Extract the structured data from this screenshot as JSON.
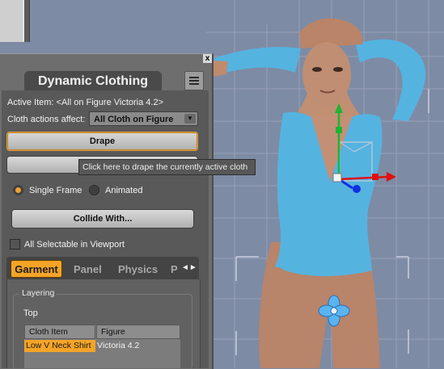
{
  "panel": {
    "title": "Dynamic Clothing",
    "close_glyph": "x",
    "active_item": "Active Item: <All on Figure Victoria 4.2>",
    "cloth_actions_label": "Cloth actions affect:",
    "cloth_actions_value": "All Cloth on Figure",
    "drape_label": "Drape",
    "second_button_label": "",
    "tooltip": "Click here to drape the currently active cloth",
    "single_frame_label": "Single Frame",
    "animated_label": "Animated",
    "frame_mode_selected": "Single Frame",
    "collide_label": "Collide With...",
    "all_selectable_label": "All Selectable in Viewport",
    "all_selectable_checked": false,
    "tabs": [
      {
        "label": "Garment",
        "active": true
      },
      {
        "label": "Panel",
        "active": false
      },
      {
        "label": "Physics",
        "active": false
      },
      {
        "label": "P",
        "active": false
      }
    ],
    "tab_nav_glyph": "◄►",
    "layering_legend": "Layering",
    "layering_top_label": "Top",
    "table": {
      "headers": [
        "Cloth Item",
        "Figure"
      ],
      "rows": [
        {
          "cloth_item": "Low V Neck Shirt",
          "figure": "Victoria 4.2",
          "selected": true
        }
      ]
    }
  },
  "icons": [
    "close-icon",
    "menu-icon",
    "dropdown-arrow-icon",
    "tab-nav-icon",
    "universal-manipulator-icon"
  ],
  "colors": {
    "accent": "#f4a426",
    "viewport": "#7e8ba4",
    "panel": "#595959",
    "shirt": "#55b3e0"
  }
}
